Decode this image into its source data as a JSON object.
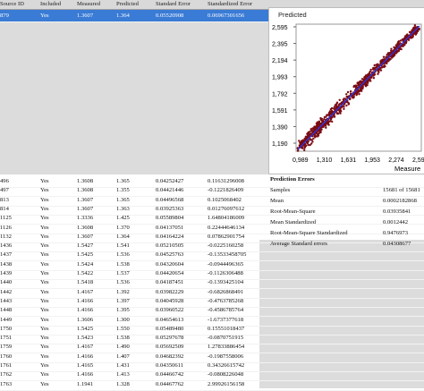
{
  "columns": [
    "Source ID",
    "Included",
    "Measured",
    "Predicted",
    "Standard Error",
    "Standardized Error"
  ],
  "rows_top": [
    {
      "id": "879",
      "inc": "Yes",
      "meas": "1.3607",
      "pred": "1.364",
      "se": "0.05520908",
      "ste": "0.06967301656"
    }
  ],
  "rows": [
    {
      "id": "496",
      "inc": "Yes",
      "meas": "1.3608",
      "pred": "1.365",
      "se": "0.04252427",
      "ste": "0.11631296008"
    },
    {
      "id": "497",
      "inc": "Yes",
      "meas": "1.3608",
      "pred": "1.355",
      "se": "0.04421446",
      "ste": "-0.1221826409"
    },
    {
      "id": "813",
      "inc": "Yes",
      "meas": "1.3607",
      "pred": "1.365",
      "se": "0.04496568",
      "ste": "0.1025068402"
    },
    {
      "id": "814",
      "inc": "Yes",
      "meas": "1.3607",
      "pred": "1.363",
      "se": "0.03925363",
      "ste": "0.01276097612"
    },
    {
      "id": "1125",
      "inc": "Yes",
      "meas": "1.3336",
      "pred": "1.425",
      "se": "0.05589804",
      "ste": "1.64804186009"
    },
    {
      "id": "1126",
      "inc": "Yes",
      "meas": "1.3608",
      "pred": "1.370",
      "se": "0.04137051",
      "ste": "0.22444646134"
    },
    {
      "id": "1132",
      "inc": "Yes",
      "meas": "1.3607",
      "pred": "1.364",
      "se": "0.04164224",
      "ste": "0.07862901754"
    },
    {
      "id": "1436",
      "inc": "Yes",
      "meas": "1.5427",
      "pred": "1.541",
      "se": "0.05210505",
      "ste": "-0.0225160258"
    },
    {
      "id": "1437",
      "inc": "Yes",
      "meas": "1.5425",
      "pred": "1.536",
      "se": "0.04525763",
      "ste": "-0.13533458705"
    },
    {
      "id": "1438",
      "inc": "Yes",
      "meas": "1.5424",
      "pred": "1.538",
      "se": "0.04320604",
      "ste": "-0.0944496365"
    },
    {
      "id": "1439",
      "inc": "Yes",
      "meas": "1.5422",
      "pred": "1.537",
      "se": "0.04420654",
      "ste": "-0.1126306488"
    },
    {
      "id": "1440",
      "inc": "Yes",
      "meas": "1.5418",
      "pred": "1.536",
      "se": "0.04187451",
      "ste": "-0.1393425104"
    },
    {
      "id": "1442",
      "inc": "Yes",
      "meas": "1.4167",
      "pred": "1.392",
      "se": "0.03982229",
      "ste": "-0.6826868491"
    },
    {
      "id": "1443",
      "inc": "Yes",
      "meas": "1.4166",
      "pred": "1.397",
      "se": "0.04045928",
      "ste": "-0.4763785268"
    },
    {
      "id": "1448",
      "inc": "Yes",
      "meas": "1.4166",
      "pred": "1.395",
      "se": "0.03960522",
      "ste": "-0.4586785764"
    },
    {
      "id": "1449",
      "inc": "Yes",
      "meas": "1.3606",
      "pred": "1.300",
      "se": "0.04654613",
      "ste": "-1.6737377618"
    },
    {
      "id": "1750",
      "inc": "Yes",
      "meas": "1.5425",
      "pred": "1.550",
      "se": "0.05489480",
      "ste": "0.15551018437"
    },
    {
      "id": "1751",
      "inc": "Yes",
      "meas": "1.5423",
      "pred": "1.538",
      "se": "0.05297678",
      "ste": "-0.0870751915"
    },
    {
      "id": "1759",
      "inc": "Yes",
      "meas": "1.4167",
      "pred": "1.490",
      "se": "0.05692509",
      "ste": "1.27833886454"
    },
    {
      "id": "1760",
      "inc": "Yes",
      "meas": "1.4166",
      "pred": "1.407",
      "se": "0.04682392",
      "ste": "-0.1987558006"
    },
    {
      "id": "1761",
      "inc": "Yes",
      "meas": "1.4165",
      "pred": "1.431",
      "se": "0.04350611",
      "ste": "0.34326615742"
    },
    {
      "id": "1762",
      "inc": "Yes",
      "meas": "1.4166",
      "pred": "1.413",
      "se": "0.04466742",
      "ste": "-0.0808226048"
    },
    {
      "id": "1763",
      "inc": "Yes",
      "meas": "1.1941",
      "pred": "1.328",
      "se": "0.04467762",
      "ste": "2.99926156158"
    }
  ],
  "plot": {
    "title": "Predicted",
    "xlabel": "Measure",
    "yticks": [
      "2,595",
      "2,395",
      "2,194",
      "1,993",
      "1,792",
      "1,591",
      "1,390",
      "1,190"
    ],
    "xticks": [
      "0,989",
      "1,310",
      "1,631",
      "1,953",
      "2,274",
      "2,59"
    ],
    "point_color": "#7a0c14",
    "line_color": "#1f3cff"
  },
  "prediction_errors": {
    "title": "Prediction Errors",
    "items": [
      {
        "label": "Samples",
        "value": "15681 of 15681"
      },
      {
        "label": "Mean",
        "value": "0.0002182868"
      },
      {
        "label": "Root-Mean-Square",
        "value": "0.03935841"
      },
      {
        "label": "Mean Standardized",
        "value": "0.0012442"
      },
      {
        "label": "Root-Mean-Square Standardized",
        "value": "0.9476973"
      },
      {
        "label": "Average Standard errors",
        "value": "0.04308677"
      }
    ]
  },
  "selected_index": 0
}
